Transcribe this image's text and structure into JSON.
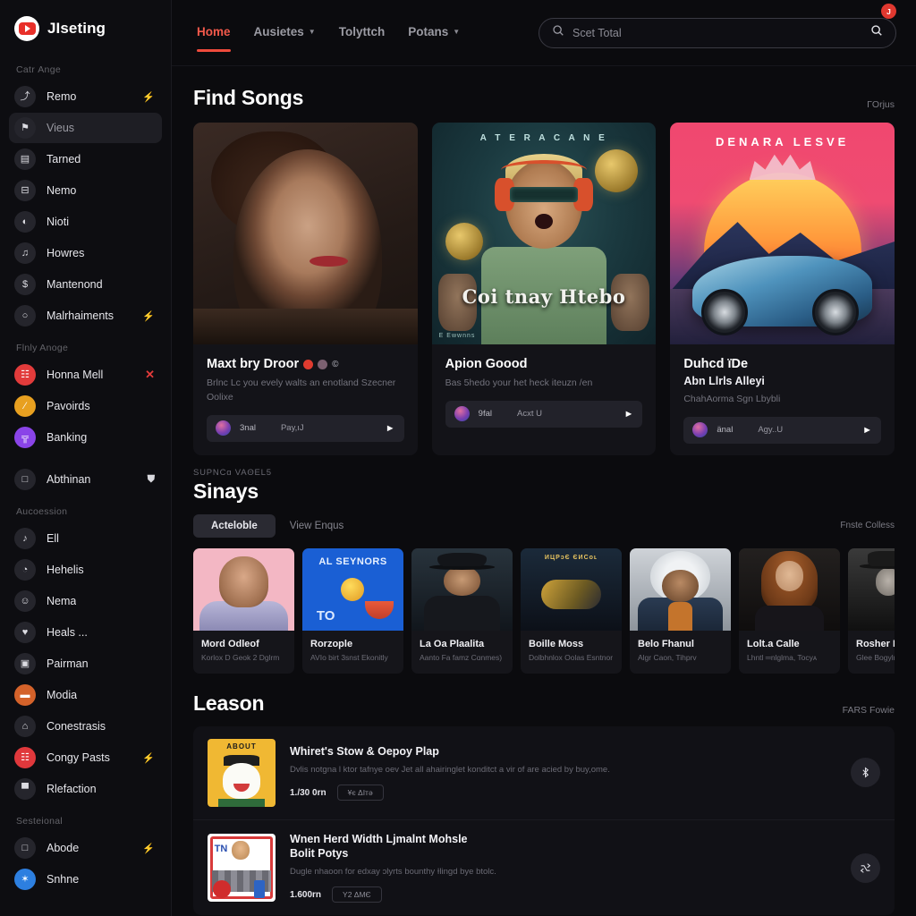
{
  "brand": {
    "name": "JIseting",
    "logo_icon": "youtube-play-logo"
  },
  "sidebar": {
    "groups": [
      {
        "label": "Catr Ange",
        "items": [
          {
            "label": "Remo",
            "icon": "antenna-icon",
            "badge": "⚡",
            "badge_kind": "bolt",
            "color": "",
            "active": false
          },
          {
            "label": "Vieus",
            "icon": "pin-icon",
            "badge": "",
            "badge_kind": "",
            "color": "",
            "active": true
          },
          {
            "label": "Tarned",
            "icon": "archive-icon",
            "badge": "",
            "badge_kind": "",
            "color": "",
            "active": false
          },
          {
            "label": "Nemo",
            "icon": "window-icon",
            "badge": "",
            "badge_kind": "",
            "color": "",
            "active": false
          },
          {
            "label": "Nioti",
            "icon": "globe-icon",
            "badge": "",
            "badge_kind": "",
            "color": "",
            "active": false
          },
          {
            "label": "Howres",
            "icon": "music-note-icon",
            "badge": "",
            "badge_kind": "",
            "color": "",
            "active": false
          },
          {
            "label": "Mantenond",
            "icon": "dollar-icon",
            "badge": "",
            "badge_kind": "",
            "color": "",
            "active": false
          },
          {
            "label": "Malrhaiments",
            "icon": "circle-icon",
            "badge": "⚡",
            "badge_kind": "bolt",
            "color": "",
            "active": false
          }
        ]
      },
      {
        "label": "Flnly Anoge",
        "items": [
          {
            "label": "Honna Mell",
            "icon": "building-icon",
            "badge": "✕",
            "badge_kind": "x",
            "color": "c-red",
            "active": false
          },
          {
            "label": "Pavoirds",
            "icon": "percent-icon",
            "badge": "",
            "badge_kind": "",
            "color": "c-orange",
            "active": false
          },
          {
            "label": "Banking",
            "icon": "bank-icon",
            "badge": "",
            "badge_kind": "",
            "color": "c-purple",
            "active": false
          }
        ]
      },
      {
        "label": "",
        "items": [
          {
            "label": "Abthinan",
            "icon": "square-icon",
            "badge": "⛊",
            "badge_kind": "shield",
            "color": "",
            "active": false
          }
        ]
      },
      {
        "label": "Aucoession",
        "items": [
          {
            "label": "Ell",
            "icon": "note-icon",
            "badge": "",
            "badge_kind": "",
            "color": "",
            "active": false
          },
          {
            "label": "Hehelis",
            "icon": "clock-icon",
            "badge": "",
            "badge_kind": "",
            "color": "",
            "active": false
          },
          {
            "label": "Nema",
            "icon": "smiley-icon",
            "badge": "",
            "badge_kind": "",
            "color": "",
            "active": false
          },
          {
            "label": "Heals ...",
            "icon": "heart-icon",
            "badge": "",
            "badge_kind": "",
            "color": "",
            "active": false
          },
          {
            "label": "Pairman",
            "icon": "robot-icon",
            "badge": "",
            "badge_kind": "",
            "color": "",
            "active": false
          },
          {
            "label": "Modia",
            "icon": "card-icon",
            "badge": "",
            "badge_kind": "",
            "color": "c-deeporange",
            "active": false
          },
          {
            "label": "Conestrasis",
            "icon": "bag-icon",
            "badge": "",
            "badge_kind": "",
            "color": "",
            "active": false
          },
          {
            "label": "Congy Pasts",
            "icon": "book-icon",
            "badge": "⚡",
            "badge_kind": "bolt",
            "color": "c-crimson",
            "active": false
          },
          {
            "label": "Rlefaction",
            "icon": "chart-icon",
            "badge": "",
            "badge_kind": "",
            "color": "",
            "active": false
          }
        ]
      },
      {
        "label": "Sesteional",
        "items": [
          {
            "label": "Abode",
            "icon": "square-icon",
            "badge": "⚡",
            "badge_kind": "bolt",
            "color": "",
            "active": false
          },
          {
            "label": "Snhne",
            "icon": "star-icon",
            "badge": "",
            "badge_kind": "",
            "color": "c-blue",
            "active": false
          }
        ]
      }
    ]
  },
  "topbar": {
    "nav": [
      {
        "label": "Home",
        "caret": false,
        "active": true
      },
      {
        "label": "Ausietes",
        "caret": true,
        "active": false
      },
      {
        "label": "Tolyttch",
        "caret": false,
        "active": false
      },
      {
        "label": "Potans",
        "caret": true,
        "active": false
      }
    ],
    "search": {
      "placeholder": "Scet Total",
      "value": ""
    },
    "notification_badge": "J"
  },
  "find_songs": {
    "title": "Find Songs",
    "link": "ΓOrjus",
    "cards": [
      {
        "art": "portrait-woman",
        "title": "Maxt bry Droor",
        "has_dots": true,
        "copyright": "©",
        "subtitle": "",
        "desc": "Brlnc Lc you evely walts an enotland Szecner Oolixe",
        "player": {
          "artist": "3nal",
          "track": "Pay,ıJ",
          "play_icon": "play-icon"
        }
      },
      {
        "art": "cosmic-rapper",
        "title": "Apion Goood",
        "has_dots": false,
        "copyright": "",
        "subtitle": "",
        "desc": "Bas 5hedo your het heck iteuzn /en",
        "overlay_top": "A T E R A C A N E",
        "overlay_title": "Coi tnay\nHtebo",
        "overlay_corner": "E Ewwnns",
        "player": {
          "artist": "9fal",
          "track": "Acxt U",
          "play_icon": "play-icon"
        }
      },
      {
        "art": "synthwave-car",
        "title": "Duhcd ïDe",
        "has_dots": false,
        "copyright": "",
        "subtitle": "Abn Llrls Alleyi",
        "desc": "ChahAorma Sgn Lbybli",
        "overlay_top": "DENARA LESVE",
        "player": {
          "artist": "änal",
          "track": "Agy..U",
          "play_icon": "play-icon"
        }
      }
    ]
  },
  "artists": {
    "eyebrow": "SUPNCɑ VAΘEL5",
    "title": "Sinays",
    "tabs": [
      {
        "label": "Acteloble",
        "active": true
      },
      {
        "label": "View Enqus",
        "active": false
      }
    ],
    "tabs_right": "Fnste Colless",
    "cards": [
      {
        "name": "Mord Odleof",
        "sub": "Korlox D\nGeok 2 Dglrm",
        "art": "a1"
      },
      {
        "name": "Rorzople",
        "sub": "AVIo birt\n3snst Ekonitly",
        "art": "a2"
      },
      {
        "name": "La Oa Plaalita",
        "sub": "Aanto Fa\nfamz Cɑnmes)",
        "art": "a3"
      },
      {
        "name": "Boille Moss",
        "sub": "Dolbhnlox\nOolas Esntnor",
        "art": "a4"
      },
      {
        "name": "Belo Fhanul",
        "sub": "Algr Caon, Tihprv",
        "art": "a5"
      },
      {
        "name": "Lolt.a Calle",
        "sub": "Lhntl ═nlglma, Tocyᴀ",
        "art": "a6"
      },
      {
        "name": "Rosher Γ",
        "sub": "Glee Bogylmis",
        "art": "a7"
      }
    ]
  },
  "leason": {
    "title": "Leason",
    "link": "FARS Fowie",
    "rows": [
      {
        "thumb": "about-food-cartoon",
        "title": "Whiret's Stow & Oepoy  Plap",
        "title2": "",
        "desc": "Dvlis notgna l ktor tafnye oev Jet all ahairinglet konditct a vir of are acied by buy,ome.",
        "count": "1./30 0rn",
        "tag": "Ұє ΔІтә",
        "action_icon": "bluetooth-icon"
      },
      {
        "thumb": "tnt-crowd-cartoon",
        "title": "Wnen Herd Width Ljmalnt Mohsle",
        "title2": "Bolit Potys",
        "desc": "Dugle nhaoon for edxay ɔlyrts bounthy Ɨlingd bye btolc.",
        "count": "1.600rn",
        "tag": "Y2 ΔMЄ",
        "action_icon": "shuffle-icon"
      }
    ]
  }
}
